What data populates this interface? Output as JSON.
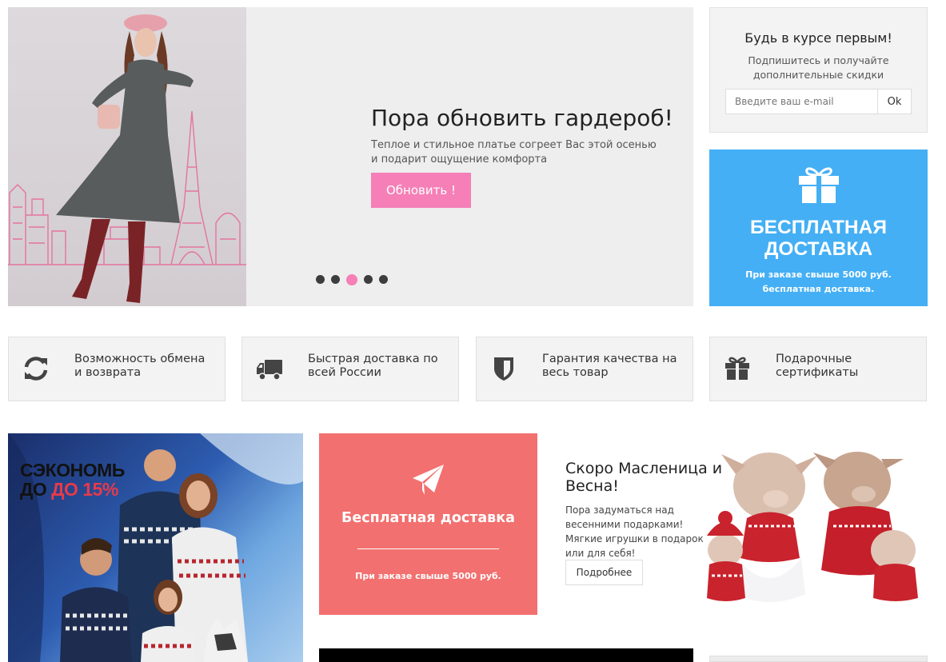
{
  "hero": {
    "title": "Пора обновить гардероб!",
    "text": "Теплое и стильное платье согреет Вас этой осенью и подарит ощущение комфорта",
    "button": "Обновить !",
    "slides": 5,
    "active_slide": 3
  },
  "newsletter": {
    "title": "Будь в курсе первым!",
    "subtitle": "Подпишитесь и получайте дополнительные скидки",
    "placeholder": "Введите ваш e-mail",
    "button": "Ok"
  },
  "free_delivery_banner": {
    "icon": "gift-icon",
    "title_line1": "БЕСПЛАТНАЯ",
    "title_line2": "ДОСТАВКА",
    "subtitle": "При заказе свыше 5000 руб. бесплатная доставка."
  },
  "features": [
    {
      "icon": "refresh-icon",
      "line1": "Возможность обмена",
      "line2": "и возврата"
    },
    {
      "icon": "truck-icon",
      "line1": "Быстрая доставка по",
      "line2": "всей России"
    },
    {
      "icon": "shield-icon",
      "line1": "Гарантия качества на",
      "line2": "весь товар"
    },
    {
      "icon": "gift-icon",
      "line1": "Подарочные",
      "line2": "сертификаты"
    }
  ],
  "promo": {
    "line1": "СЭКОНОМЬ",
    "line2_prefix": "ДО",
    "line2_accent": "ДО 15%"
  },
  "coral_banner": {
    "icon": "paper-plane-icon",
    "title": "Бесплатная доставка",
    "subtitle": "При заказе свыше 5000 руб."
  },
  "spring": {
    "title": "Скоро Масленица и Весна!",
    "text": "Пора задуматься над весенними подарками! Мягкие игрушки в подарок или для себя!",
    "button": "Подробнее"
  },
  "colors": {
    "pink": "#f57fb6",
    "blue": "#44aff4",
    "coral": "#f2706f",
    "panel": "#f3f3f3"
  }
}
